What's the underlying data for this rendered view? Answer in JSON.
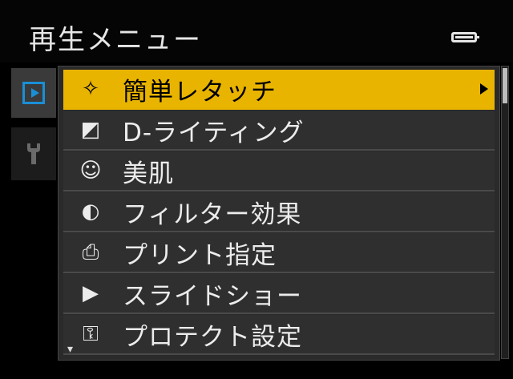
{
  "header": {
    "title": "再生メニュー",
    "battery_icon": "battery-full-icon"
  },
  "tabs": [
    {
      "icon": "play-menu-icon",
      "active": true
    },
    {
      "icon": "wrench-setup-icon",
      "active": false
    }
  ],
  "menu": {
    "items": [
      {
        "label": "簡単レタッチ",
        "icon": "retouch-icon",
        "glyph": "✧"
      },
      {
        "label": "D-ライティング",
        "icon": "d-lighting-icon",
        "glyph": "◩"
      },
      {
        "label": "美肌",
        "icon": "skin-softening-icon",
        "glyph": "☺"
      },
      {
        "label": "フィルター効果",
        "icon": "filter-effect-icon",
        "glyph": "◐"
      },
      {
        "label": "プリント指定",
        "icon": "print-order-icon",
        "glyph": "⎙"
      },
      {
        "label": "スライドショー",
        "icon": "slideshow-icon",
        "glyph": "▶"
      },
      {
        "label": "プロテクト設定",
        "icon": "protect-key-icon",
        "glyph": "⚿"
      }
    ],
    "selected_index": 0
  },
  "colors": {
    "highlight": "#e8b400",
    "tab_accent": "#1a8fd6",
    "background": "#000000"
  }
}
